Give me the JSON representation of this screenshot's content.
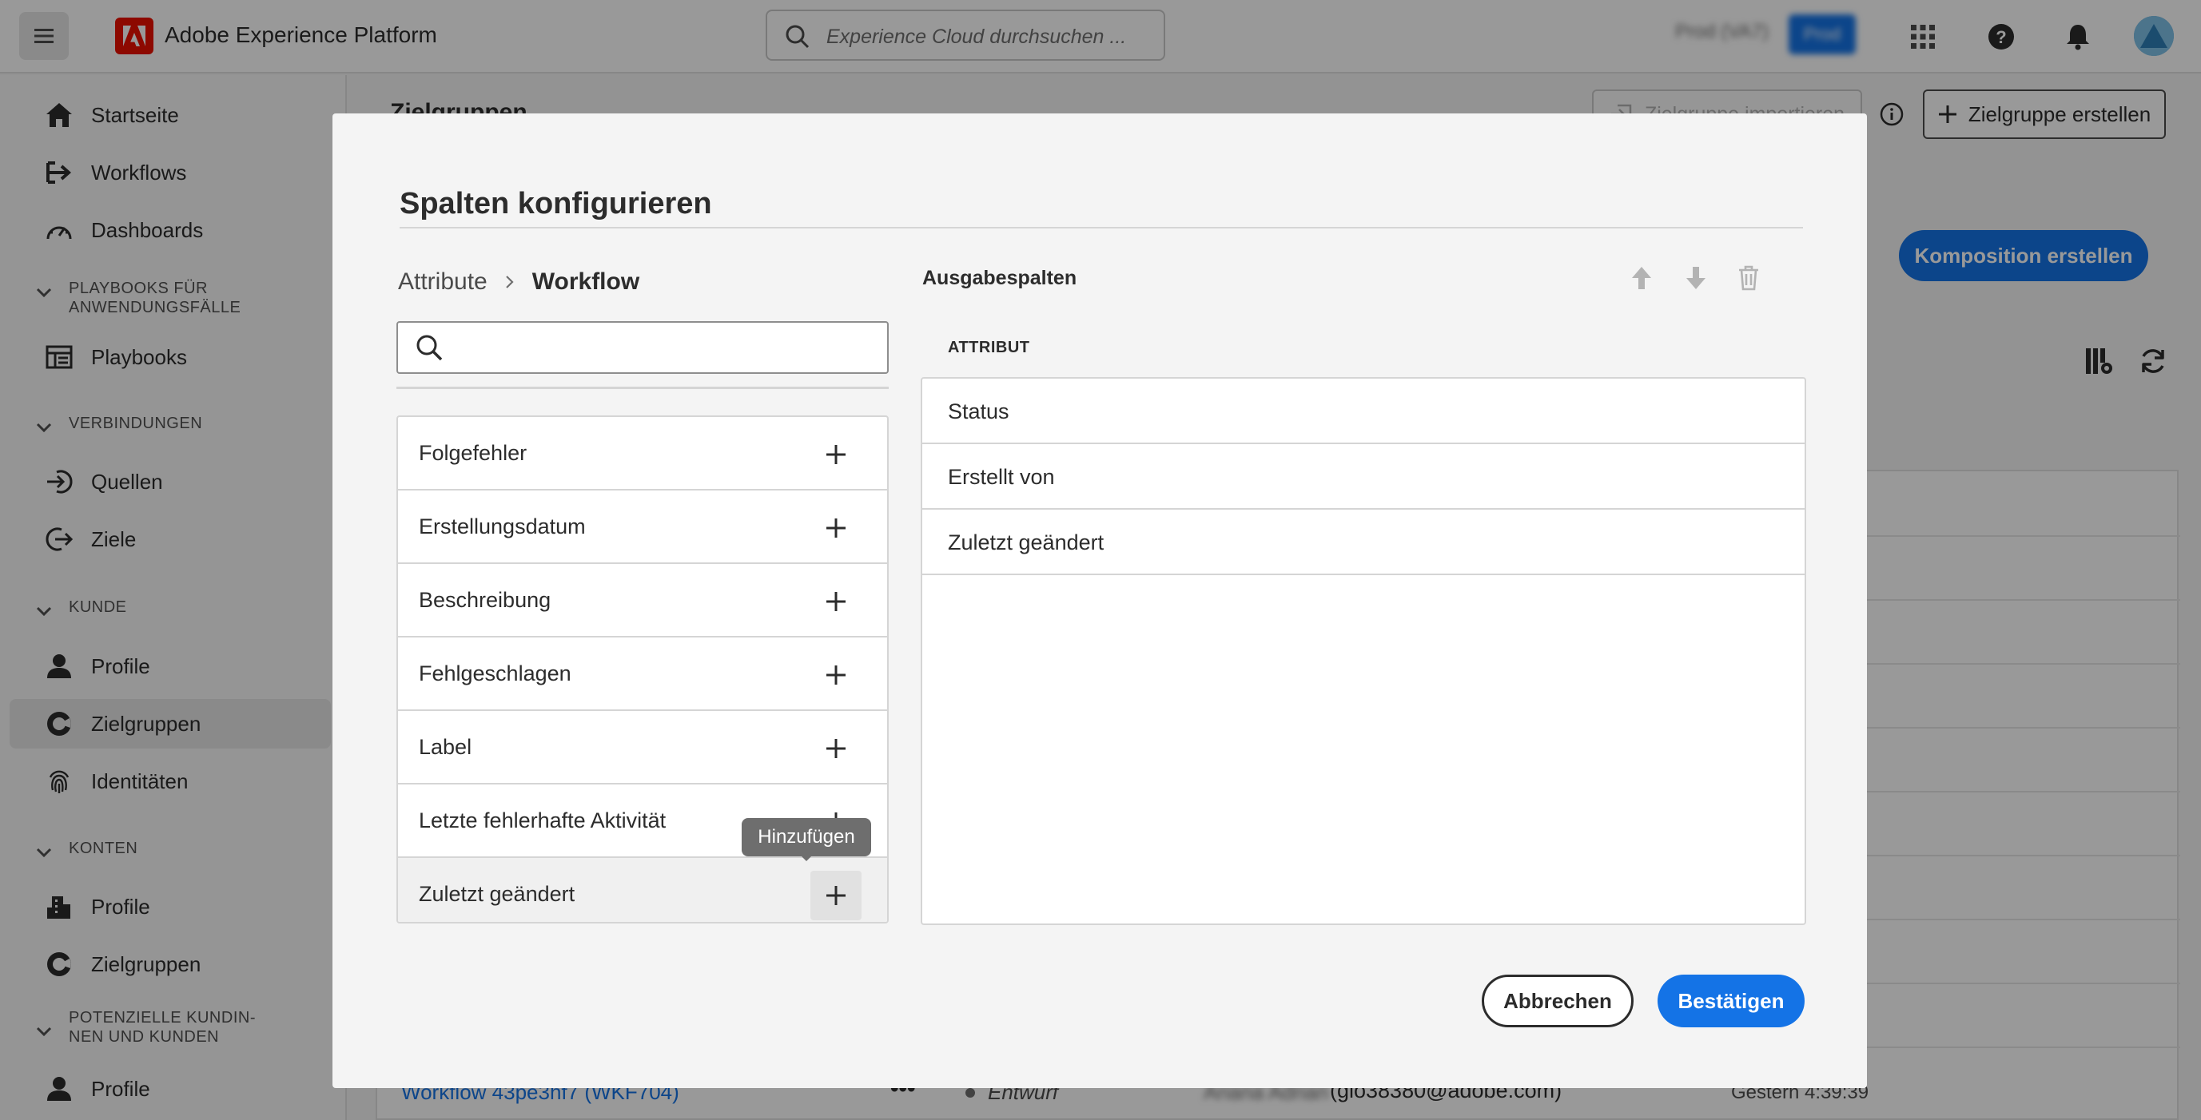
{
  "topbar": {
    "app_title": "Adobe Experience Platform",
    "search_placeholder": "Experience Cloud durchsuchen ...",
    "sandbox_label": "Prod (VA7)",
    "sandbox_badge": "Prod"
  },
  "sidebar": {
    "items": [
      {
        "label": "Startseite",
        "icon": "home-icon"
      },
      {
        "label": "Workflows",
        "icon": "workflow-icon"
      },
      {
        "label": "Dashboards",
        "icon": "dashboard-icon"
      }
    ],
    "sections": [
      {
        "label_line1": "PLAYBOOKS FÜR",
        "label_line2": "ANWENDUNGSFÄLLE",
        "items": [
          {
            "label": "Playbooks",
            "icon": "playbook-icon"
          }
        ]
      },
      {
        "label_line1": "VERBINDUNGEN",
        "label_line2": "",
        "items": [
          {
            "label": "Quellen",
            "icon": "sources-icon"
          },
          {
            "label": "Ziele",
            "icon": "destinations-icon"
          }
        ]
      },
      {
        "label_line1": "KUNDE",
        "label_line2": "",
        "items": [
          {
            "label": "Profile",
            "icon": "profile-icon"
          },
          {
            "label": "Zielgruppen",
            "icon": "audiences-icon",
            "selected": true
          },
          {
            "label": "Identitäten",
            "icon": "fingerprint-icon"
          }
        ]
      },
      {
        "label_line1": "KONTEN",
        "label_line2": "",
        "items": [
          {
            "label": "Profile",
            "icon": "building-icon"
          },
          {
            "label": "Zielgruppen",
            "icon": "audiences-icon"
          }
        ]
      },
      {
        "label_line1": "POTENZIELLE KUNDIN-",
        "label_line2": "NEN UND KUNDEN",
        "items": [
          {
            "label": "Profile",
            "icon": "profile-icon"
          }
        ]
      }
    ]
  },
  "background": {
    "page_title": "Zielgruppen",
    "import_button": "Zielgruppe importieren",
    "create_audience_button": "Zielgruppe erstellen",
    "composition_button": "Komposition erstellen",
    "row": {
      "name": "Workflow 43pe3hf7 (WKF704)",
      "status": "Entwurf",
      "owner": "Ariana Adrian",
      "email": "(glo38380@adobe.com)",
      "modified": "Gestern 4:39:39"
    }
  },
  "dialog": {
    "title": "Spalten konfigurieren",
    "breadcrumb": {
      "root": "Attribute",
      "current": "Workflow"
    },
    "search_placeholder": "",
    "attributes": [
      {
        "label": "Folgefehler"
      },
      {
        "label": "Erstellungsdatum"
      },
      {
        "label": "Beschreibung"
      },
      {
        "label": "Fehlgeschlagen"
      },
      {
        "label": "Label"
      },
      {
        "label": "Letzte fehlerhafte Aktivität"
      },
      {
        "label": "Zuletzt geändert"
      }
    ],
    "tooltip": "Hinzufügen",
    "output_title": "Ausgabespalten",
    "output_column_header": "ATTRIBUT",
    "output_columns": [
      {
        "label": "Status"
      },
      {
        "label": "Erstellt von"
      },
      {
        "label": "Zuletzt geändert"
      }
    ],
    "cancel_button": "Abbrechen",
    "confirm_button": "Bestätigen"
  },
  "colors": {
    "accent": "#1473e6",
    "adobe_red": "#eb1000",
    "overlay": "rgba(0,0,0,0.4)"
  }
}
